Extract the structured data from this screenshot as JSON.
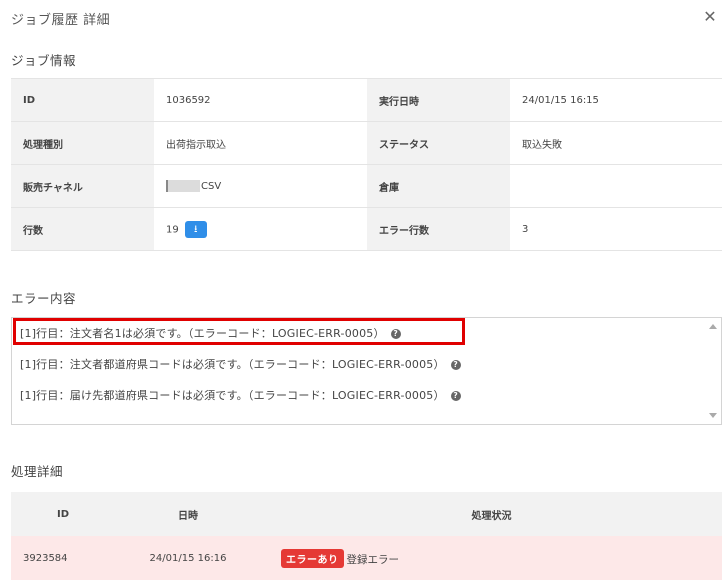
{
  "modal": {
    "title": "ジョブ履歴 詳細",
    "close_glyph": "✕"
  },
  "job_info": {
    "section_title": "ジョブ情報",
    "rows": [
      {
        "label1": "ID",
        "value1": "1036592",
        "label2": "実行日時",
        "value2": "24/01/15 16:15"
      },
      {
        "label1": "処理種別",
        "value1": "出荷指示取込",
        "label2": "ステータス",
        "value2": "取込失敗"
      },
      {
        "label1": "販売チャネル",
        "value1": "CSV",
        "label2": "倉庫",
        "value2": ""
      },
      {
        "label1": "行数",
        "value1": "19",
        "label2": "エラー行数",
        "value2": "3"
      }
    ],
    "download_icon": "download-icon"
  },
  "errors": {
    "section_title": "エラー内容",
    "lines": [
      "[1]行目：注文者名1は必須です。（エラーコード：LOGIEC-ERR-0005）",
      "[1]行目：注文者都道府県コードは必須です。（エラーコード：LOGIEC-ERR-0005）",
      "[1]行目：届け先都道府県コードは必須です。（エラーコード：LOGIEC-ERR-0005）"
    ],
    "help_glyph": "?",
    "highlight_color": "#e00000"
  },
  "process_detail": {
    "section_title": "処理詳細",
    "headers": {
      "id": "ID",
      "datetime": "日時",
      "status": "処理状況"
    },
    "rows": [
      {
        "id": "3923584",
        "datetime": "24/01/15 16:16",
        "badge": "エラーあり",
        "status": "登録エラー"
      }
    ],
    "badge_color": "#e53935",
    "row_bg": "#fde8e8"
  }
}
